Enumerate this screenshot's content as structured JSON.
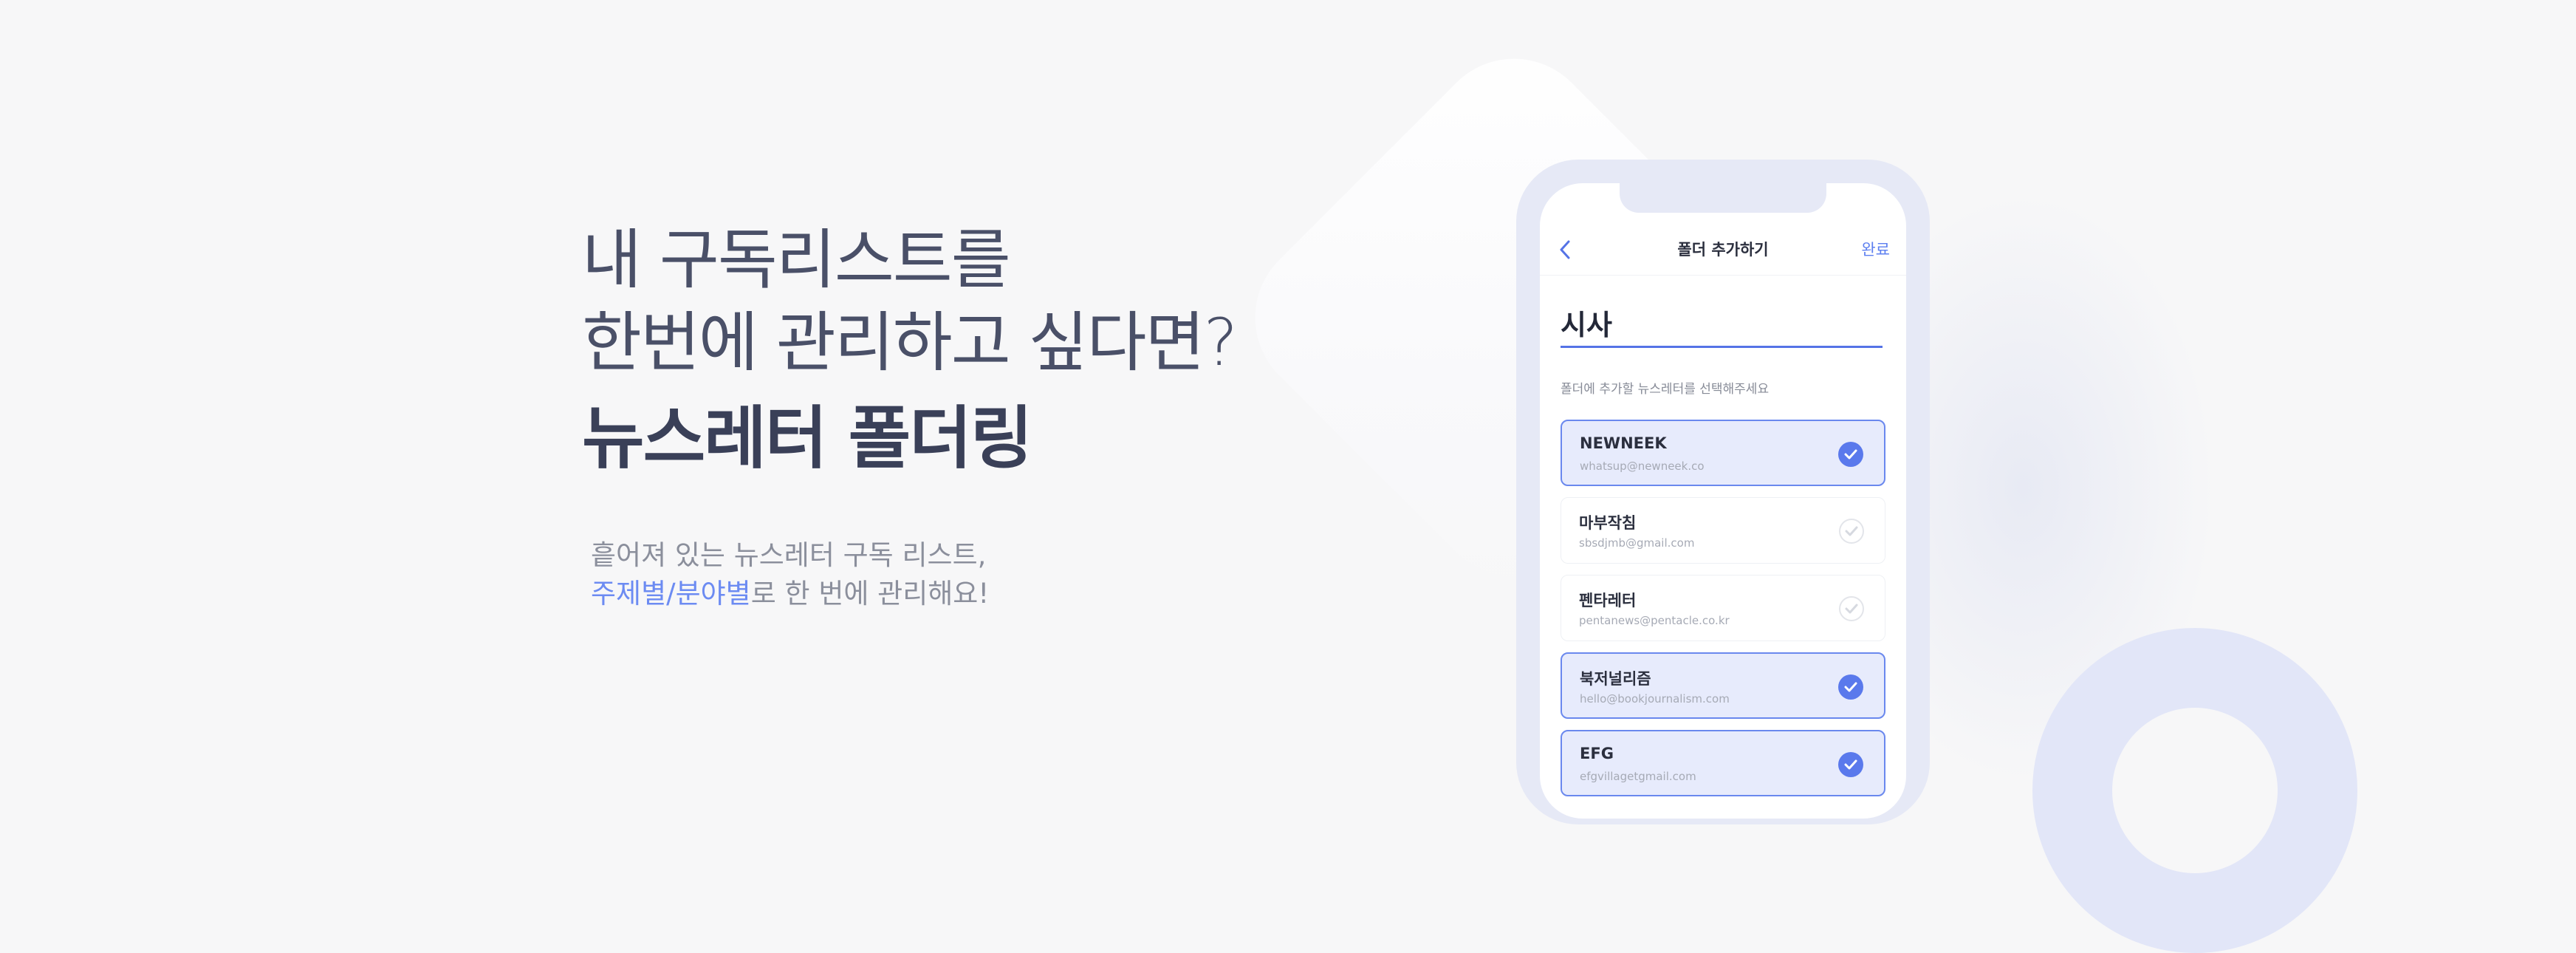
{
  "hero": {
    "headline_line1": "내 구독리스트를",
    "headline_line2": "한번에 관리하고 싶다면?",
    "headline_strong": "뉴스레터 폴더링",
    "desc_line1": "흩어져 있는 뉴스레터 구독 리스트,",
    "desc_highlight": "주제별/분야별",
    "desc_line2_rest": "로 한 번에 관리해요!"
  },
  "phone": {
    "nav": {
      "title": "폴더 추가하기",
      "done_label": "완료",
      "back_icon": "chevron-left-icon"
    },
    "folder_name_value": "시사",
    "helper_text": "폴더에 추가할 뉴스레터를 선택해주세요",
    "newsletters": [
      {
        "name": "NEWNEEK",
        "email": "whatsup@newneek.co",
        "selected": true
      },
      {
        "name": "마부작침",
        "email": "sbsdjmb@gmail.com",
        "selected": false
      },
      {
        "name": "펜타레터",
        "email": "pentanews@pentacle.co.kr",
        "selected": false
      },
      {
        "name": "북저널리즘",
        "email": "hello@bookjournalism.com",
        "selected": true
      },
      {
        "name": "EFG",
        "email": "efgvillagetgmail.com",
        "selected": true
      }
    ]
  },
  "colors": {
    "accent": "#5a79ec",
    "highlight_text": "#6c8bf2",
    "headline": "#4a5068",
    "background": "#f7f7f8"
  }
}
